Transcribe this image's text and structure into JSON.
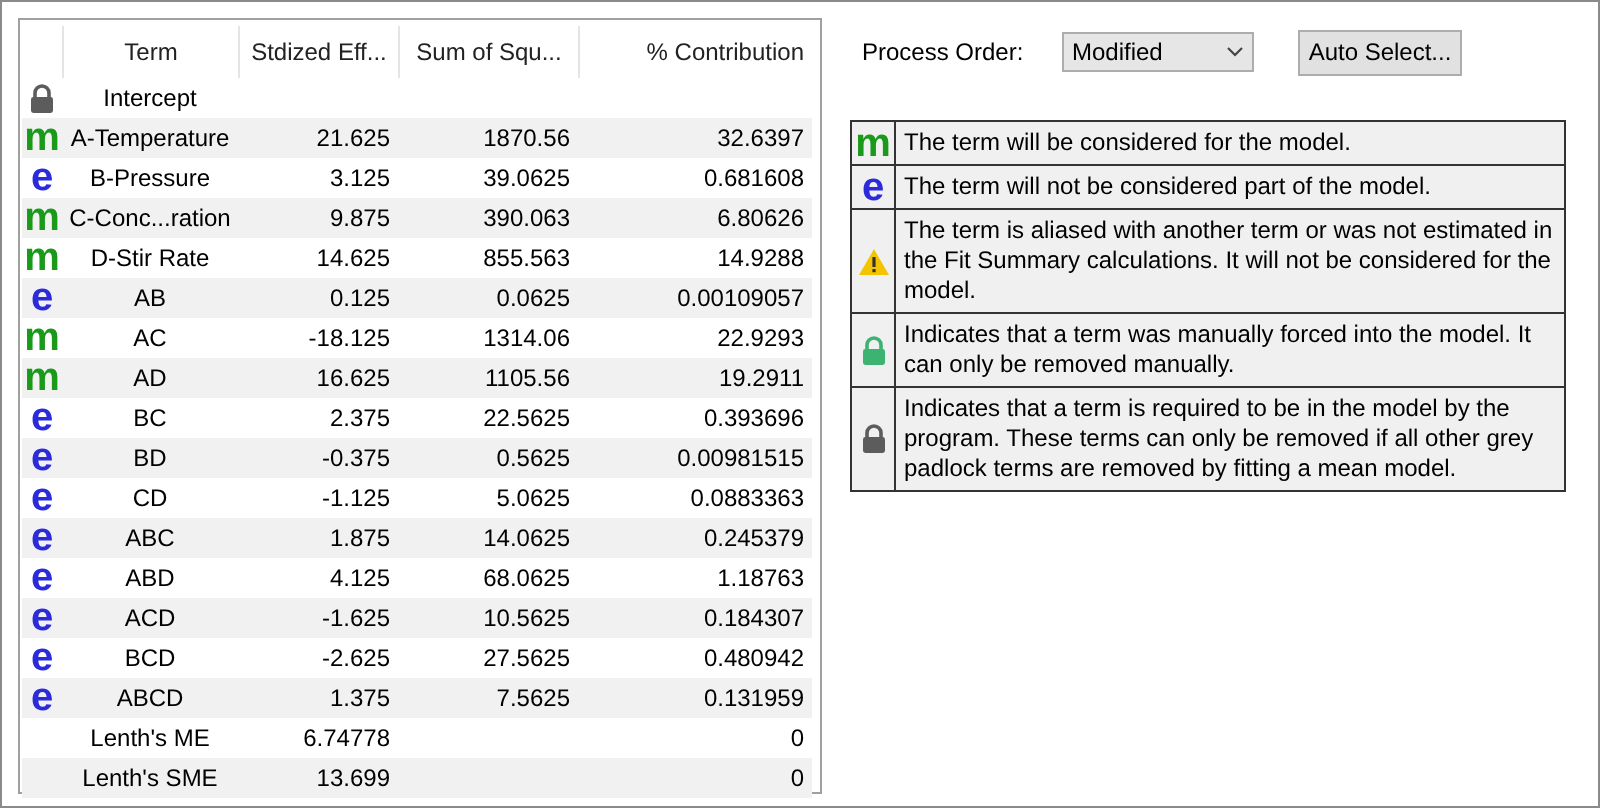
{
  "table": {
    "columns": [
      "Term",
      "Stdized Eff...",
      "Sum of Squ...",
      "% Contribution"
    ],
    "rows": [
      {
        "kind": "required",
        "term": "Intercept"
      },
      {
        "kind": "model",
        "glyph": "m",
        "term": "A-Temperature",
        "effect": "21.625",
        "ss": "1870.56",
        "contribution": "32.6397"
      },
      {
        "kind": "error",
        "glyph": "e",
        "term": "B-Pressure",
        "effect": "3.125",
        "ss": "39.0625",
        "contribution": "0.681608"
      },
      {
        "kind": "model",
        "glyph": "m",
        "term": "C-Conc...ration",
        "effect": "9.875",
        "ss": "390.063",
        "contribution": "6.80626"
      },
      {
        "kind": "model",
        "glyph": "m",
        "term": "D-Stir Rate",
        "effect": "14.625",
        "ss": "855.563",
        "contribution": "14.9288"
      },
      {
        "kind": "error",
        "glyph": "e",
        "term": "AB",
        "effect": "0.125",
        "ss": "0.0625",
        "contribution": "0.00109057"
      },
      {
        "kind": "model",
        "glyph": "m",
        "term": "AC",
        "effect": "-18.125",
        "ss": "1314.06",
        "contribution": "22.9293"
      },
      {
        "kind": "model",
        "glyph": "m",
        "term": "AD",
        "effect": "16.625",
        "ss": "1105.56",
        "contribution": "19.2911"
      },
      {
        "kind": "error",
        "glyph": "e",
        "term": "BC",
        "effect": "2.375",
        "ss": "22.5625",
        "contribution": "0.393696"
      },
      {
        "kind": "error",
        "glyph": "e",
        "term": "BD",
        "effect": "-0.375",
        "ss": "0.5625",
        "contribution": "0.00981515"
      },
      {
        "kind": "error",
        "glyph": "e",
        "term": "CD",
        "effect": "-1.125",
        "ss": "5.0625",
        "contribution": "0.0883363"
      },
      {
        "kind": "error",
        "glyph": "e",
        "term": "ABC",
        "effect": "1.875",
        "ss": "14.0625",
        "contribution": "0.245379"
      },
      {
        "kind": "error",
        "glyph": "e",
        "term": "ABD",
        "effect": "4.125",
        "ss": "68.0625",
        "contribution": "1.18763"
      },
      {
        "kind": "error",
        "glyph": "e",
        "term": "ACD",
        "effect": "-1.625",
        "ss": "10.5625",
        "contribution": "0.184307"
      },
      {
        "kind": "error",
        "glyph": "e",
        "term": "BCD",
        "effect": "-2.625",
        "ss": "27.5625",
        "contribution": "0.480942"
      },
      {
        "kind": "error",
        "glyph": "e",
        "term": "ABCD",
        "effect": "1.375",
        "ss": "7.5625",
        "contribution": "0.131959"
      },
      {
        "kind": "none",
        "term": "Lenth's ME",
        "effect": "6.74778",
        "contribution": "0"
      },
      {
        "kind": "none",
        "term": "Lenth's SME",
        "effect": "13.699",
        "contribution": "0"
      }
    ]
  },
  "process_order": {
    "label": "Process Order:",
    "value": "Modified"
  },
  "buttons": [
    "Auto Select..."
  ],
  "legend": [
    {
      "kind": "model",
      "glyph": "m",
      "text": "The term will be considered for the model."
    },
    {
      "kind": "error",
      "glyph": "e",
      "text": "The term will not be considered part of the model."
    },
    {
      "kind": "aliased",
      "text": "The term is aliased with another term or was not estimated in the Fit Summary calculations. It will not be considered for the model."
    },
    {
      "kind": "forced",
      "text": "Indicates that a term was manually forced into the model. It can only be removed manually."
    },
    {
      "kind": "required",
      "text": "Indicates that a term is required to be in the model by the program. These terms can only be removed if all other grey padlock terms are removed by fitting a mean model."
    }
  ]
}
